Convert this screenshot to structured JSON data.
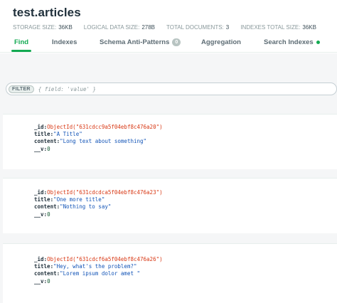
{
  "namespace": "test.articles",
  "stats": [
    {
      "label": "STORAGE SIZE:",
      "value": "36KB"
    },
    {
      "label": "LOGICAL DATA SIZE:",
      "value": "278B"
    },
    {
      "label": "TOTAL DOCUMENTS:",
      "value": "3"
    },
    {
      "label": "INDEXES TOTAL SIZE:",
      "value": "36KB"
    }
  ],
  "tabs": [
    {
      "label": "Find",
      "active": true
    },
    {
      "label": "Indexes"
    },
    {
      "label": "Schema Anti-Patterns",
      "badge": "0"
    },
    {
      "label": "Aggregation"
    },
    {
      "label": "Search Indexes"
    }
  ],
  "filter": {
    "label": "FILTER",
    "placeholder": "{ field: 'value' }"
  },
  "documents": [
    {
      "id_key": "_id:",
      "id_value": "ObjectId(\"631cdcc9a5f04ebf8c476a20\")",
      "title_key": "title:",
      "title_value": "\"A Title\"",
      "content_key": "content:",
      "content_value": "\"Long text about something\"",
      "v_key": "__v:",
      "v_value": "0"
    },
    {
      "id_key": "_id:",
      "id_value": "ObjectId(\"631cdcdca5f04ebf8c476a23\")",
      "title_key": "title:",
      "title_value": "\"One more title\"",
      "content_key": "content:",
      "content_value": "\"Nothing to say\"",
      "v_key": "__v:",
      "v_value": "0"
    },
    {
      "id_key": "_id:",
      "id_value": "ObjectId(\"631cdcf6a5f04ebf8c476a26\")",
      "title_key": "title:",
      "title_value": "\"Hey, what's the problem?\"",
      "content_key": "content:",
      "content_value": "\"Lorem ipsum dolor amet \"",
      "v_key": "__v:",
      "v_value": "0"
    }
  ]
}
